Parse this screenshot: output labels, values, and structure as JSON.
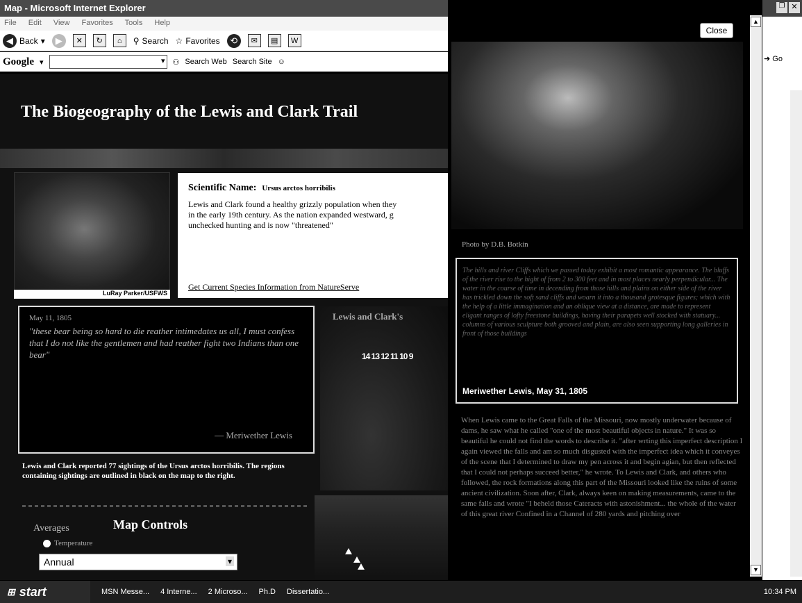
{
  "window": {
    "title": "Map - Microsoft Internet Explorer"
  },
  "menu": [
    "File",
    "Edit",
    "View",
    "Favorites",
    "Tools",
    "Help"
  ],
  "toolbar": {
    "back": "Back",
    "search": "Search",
    "favorites": "Favorites"
  },
  "google": {
    "logo": "Google",
    "search_web": "Search Web",
    "search_site": "Search Site"
  },
  "page": {
    "title": "The Biogeography of the Lewis and Clark Trail",
    "photo_credit": "LuRay Parker/USFWS",
    "sci_label": "Scientific Name:",
    "sci_name": "Ursus arctos horribilis",
    "desc1": "Lewis and Clark found a healthy grizzly population when they",
    "desc2": "in the early 19th century. As the nation expanded westward, g",
    "desc3": "unchecked hunting and is now \"threatened\"",
    "ns_link": "Get Current Species Information from NatureServe",
    "quote_date": "May 11, 1805",
    "quote_text": "\"these bear being so hard to die reather intimedates us all, I must confess that I do not like the gentlemen and had reather fight two Indians than one bear\"",
    "quote_author": "— Meriwether Lewis",
    "sightings": "Lewis and Clark reported 77 sightings of the Ursus arctos horribilis. The regions containing sightings are outlined in black on the map to the right.",
    "map_title": "Lewis and Clark's",
    "map_numbers": "14 13 12 11 10 9",
    "map_controls": "Map Controls",
    "averages": "Averages",
    "temperature": "Temperature",
    "annual": "Annual"
  },
  "popup": {
    "close": "Close",
    "photo_credit": "Photo by D.B. Botkin",
    "quote_text": "The hills and river Cliffs which we passed today exhibit a most romantic appearance. The bluffs of the river rise to the hight of from 2 to 300 feet and in most places nearly perpendicular... The water in the course of time in decending from those hills and plains on either side of the river has trickled down the soft sand cliffs and woarn it into a thousand grotesque figures; which with the help of a little immagination and an oblique view at a distance, are made to represent eligant ranges of lofty freestone buildings, having their parapets well stocked with statuary... columns of various sculpture both grooved and plain, are also seen supporting long galleries in front of those buildings",
    "quote_author": "Meriwether Lewis, May 31, 1805",
    "article": "When Lewis came to the Great Falls of the Missouri, now mostly underwater because of dams, he saw what he called \"one of the most beautiful objects in nature.\" It was so beautiful he could not find the words to describe it. \"after wrting this imperfect description I again viewed the falls and am so much disgusted with the imperfect idea which it conveyes of the scene that I determined to draw my pen across it and begin agian, but then reflected that I could not perhaps succeed better,\" he wrote. To Lewis and Clark, and others who followed, the rock formations along this part of the Missouri looked like the ruins of some ancient civilization. Soon after, Clark, always keen on making measurements, came to the same falls and wrote \"I beheld those Cateracts with astonishment... the whole of the water of this great river Confined in a Channel of 280 yards and pitching over"
  },
  "rightwin": {
    "go": "Go"
  },
  "taskbar": {
    "start": "start",
    "items": [
      "MSN Messe...",
      "4 Interne...",
      "2 Microso...",
      "Ph.D",
      "Dissertatio..."
    ],
    "clock": "10:34 PM"
  }
}
